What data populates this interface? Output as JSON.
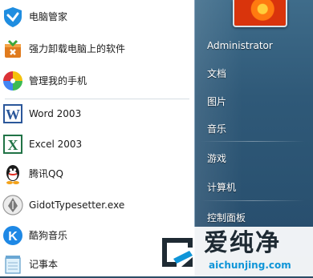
{
  "programs": [
    {
      "label": "电脑管家",
      "icon": "shield-icon"
    },
    {
      "label": "强力卸载电脑上的软件",
      "icon": "uninstall-box-icon"
    },
    {
      "label": "管理我的手机",
      "icon": "pinwheel-icon"
    },
    {
      "label": "Word 2003",
      "icon": "word-icon"
    },
    {
      "label": "Excel 2003",
      "icon": "excel-icon"
    },
    {
      "label": "腾讯QQ",
      "icon": "qq-penguin-icon"
    },
    {
      "label": "GidotTypesetter.exe",
      "icon": "pen-nib-icon"
    },
    {
      "label": "酷狗音乐",
      "icon": "kugou-icon"
    },
    {
      "label": "记事本",
      "icon": "notepad-icon"
    }
  ],
  "right_links": [
    {
      "label": "Administrator"
    },
    {
      "label": "文档"
    },
    {
      "label": "图片"
    },
    {
      "label": "音乐"
    },
    {
      "label": "游戏"
    },
    {
      "label": "计算机"
    },
    {
      "label": "控制面板"
    }
  ],
  "watermark": {
    "chinese": "爱纯净",
    "url": "aichunjing.com"
  },
  "colors": {
    "panel_blue": "#2f5978",
    "list_bg": "#ffffff",
    "watermark_url": "#0f95d8"
  }
}
